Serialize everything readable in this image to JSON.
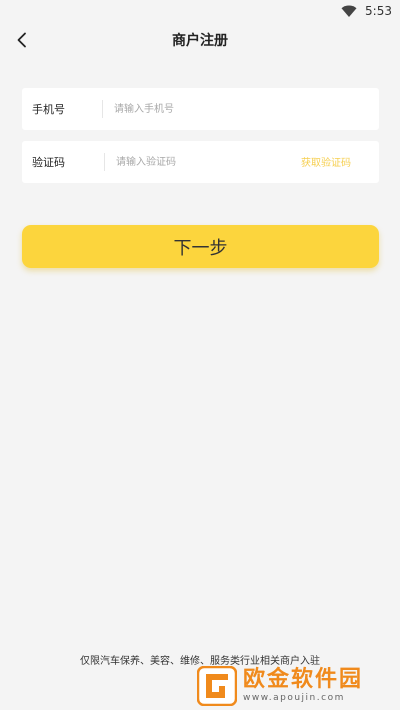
{
  "status": {
    "time": "5:53"
  },
  "header": {
    "title": "商户注册"
  },
  "form": {
    "phone": {
      "label": "手机号",
      "placeholder": "请输入手机号",
      "value": ""
    },
    "code": {
      "label": "验证码",
      "placeholder": "请输入验证码",
      "value": "",
      "action": "获取验证码"
    }
  },
  "actions": {
    "next_label": "下一步"
  },
  "footer": {
    "note": "仅限汽车保养、美容、维修、服务类行业相关商户入驻"
  },
  "watermark": {
    "name": "欧金软件园",
    "url": "www.apoujin.com"
  },
  "colors": {
    "accent": "#fcd53d",
    "link": "#f6cf50",
    "background": "#f4f4f4"
  },
  "icons": {
    "back": "chevron-left-icon",
    "wifi": "wifi-icon"
  }
}
